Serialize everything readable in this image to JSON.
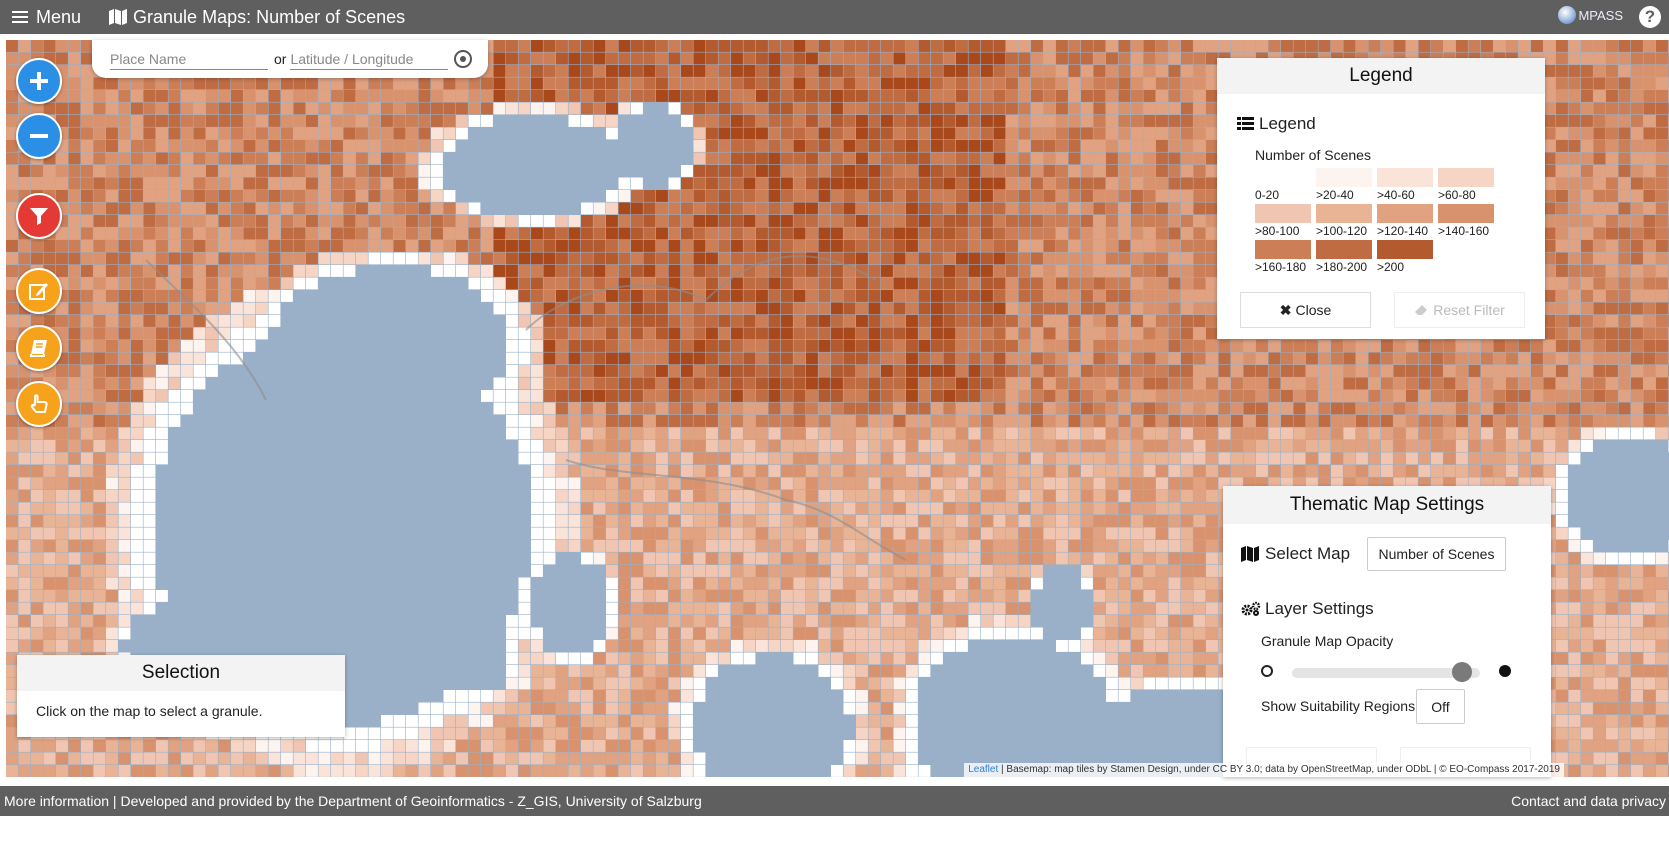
{
  "topbar": {
    "menu_label": "Menu",
    "title": "Granule Maps: Number of Scenes",
    "brand": "MPASS",
    "help_label": "?"
  },
  "search": {
    "place_placeholder": "Place Name",
    "or_label": "or",
    "latlon_placeholder": "Latitude / Longitude"
  },
  "controls": {
    "zoom_in_icon": "plus-icon",
    "zoom_out_icon": "minus-icon",
    "filter_icon": "filter-icon",
    "edit_icon": "edit-icon",
    "book_icon": "book-icon",
    "select_icon": "pointer-hand-icon"
  },
  "legend": {
    "title": "Legend",
    "subtitle": "Legend",
    "scale_title": "Number of Scenes",
    "classes": [
      {
        "label": "0-20",
        "color": "#ffffff"
      },
      {
        "label": ">20-40",
        "color": "#fdf3ef"
      },
      {
        "label": ">40-60",
        "color": "#fae4da"
      },
      {
        "label": ">60-80",
        "color": "#f6d5c5"
      },
      {
        "label": ">80-100",
        "color": "#f0c5b1"
      },
      {
        "label": ">100-120",
        "color": "#e9b396"
      },
      {
        "label": ">120-140",
        "color": "#e1a282"
      },
      {
        "label": ">140-160",
        "color": "#d8926d"
      },
      {
        "label": ">160-180",
        "color": "#cc7e56"
      },
      {
        "label": ">180-200",
        "color": "#c06c43"
      },
      {
        "label": ">200",
        "color": "#b35a2f"
      }
    ],
    "close_label": "Close",
    "reset_label": "Reset Filter"
  },
  "selection": {
    "title": "Selection",
    "text": "Click on the map to select a granule."
  },
  "thematic": {
    "title": "Thematic Map Settings",
    "select_map_label": "Select Map",
    "select_map_value": "Number of Scenes",
    "layer_settings_label": "Layer Settings",
    "opacity_label": "Granule Map Opacity",
    "opacity_value": 0.9,
    "suitability_label": "Show Suitability Regions",
    "suitability_value": "Off"
  },
  "attribution": {
    "leaflet": "Leaflet",
    "text": " | Basemap: map tiles by Stamen Design, under CC BY 3.0; data by OpenStreetMap, under ODbL | © EO-Compass 2017-2019"
  },
  "footer": {
    "left": "More information | Developed and provided by the Department of Geoinformatics - Z_GIS, University of Salzburg",
    "right": "Contact and data privacy"
  },
  "colors": {
    "topbar": "#5f5f5f",
    "ocean": "#9ab0c8",
    "zoom_blue": "#2c8fe6",
    "filter_red": "#e53935",
    "tool_orange": "#f7a21b",
    "land_darkest": "#a9481b"
  }
}
